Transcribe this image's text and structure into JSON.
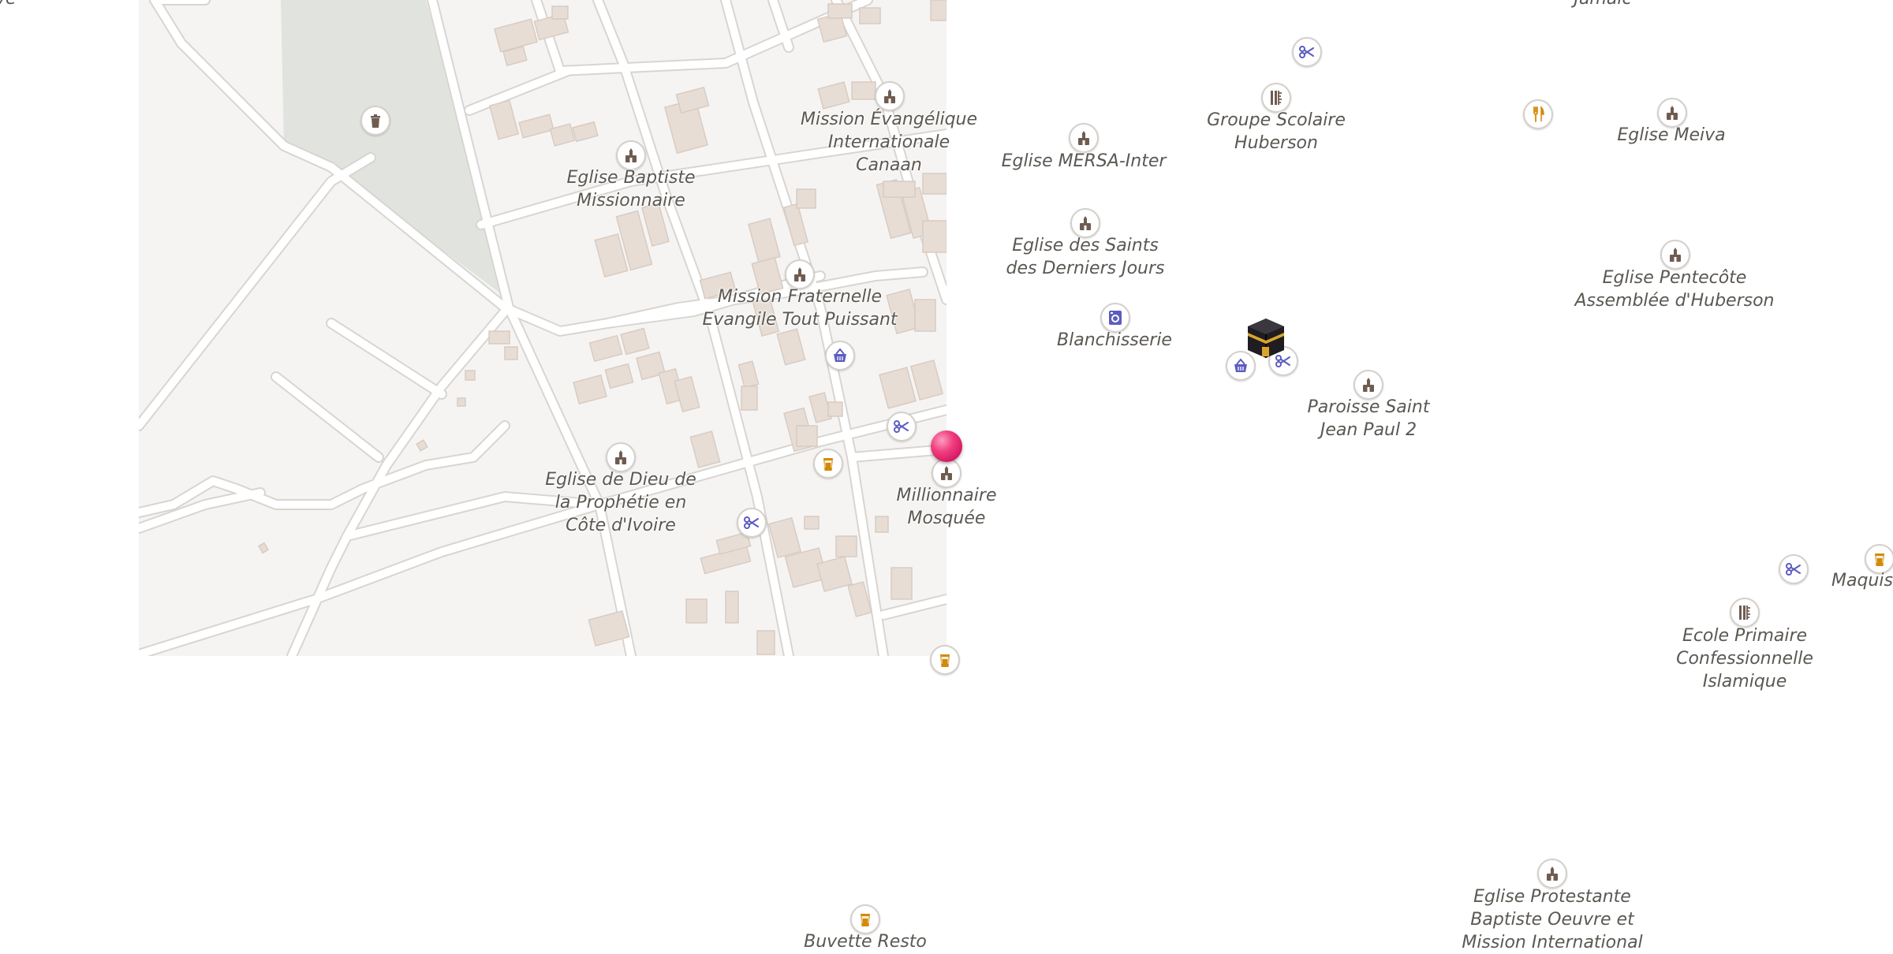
{
  "map": {
    "labels": {
      "top_left_cut": "ve",
      "top_right_cut": "Jamaic",
      "mission_evangelique": "Mission Évangélique\nInternationale\nCanaan",
      "eglise_baptiste": "Eglise Baptiste\nMissionnaire",
      "mission_fraternelle": "Mission Fraternelle\nEvangile Tout Puissant",
      "eglise_mersa": "Eglise MERSA-Inter",
      "groupe_scolaire": "Groupe Scolaire\nHuberson",
      "eglise_meiva": "Eglise Meiva",
      "eglise_saints": "Eglise des Saints\ndes Derniers Jours",
      "blanchisserie": "Blanchisserie",
      "eglise_pentecote": "Eglise Pentecôte\nAssemblée d'Huberson",
      "paroisse": "Paroisse Saint\nJean Paul 2",
      "millionnaire_mosquee": "Millionnaire\nMosquée",
      "eglise_dieu": "Eglise de Dieu de\nla Prophétie en\nCôte d'Ivoire",
      "maquis": "Maquis",
      "ecole_primaire": "Ecole Primaire\nConfessionnelle Islamique",
      "buvette_resto": "Buvette Resto",
      "eglise_protestante": "Eglise Protestante\nBaptiste Oeuvre et\nMission International"
    },
    "colors": {
      "land": "#f6f4f2",
      "building": "#e7ddd5",
      "building_edge": "#d7ccc3",
      "road": "#ffffff",
      "road_casing": "#d8d5d1",
      "park": "#e1e4de",
      "poi_brown": "#6f5c51",
      "poi_blue": "#5c5cc0",
      "poi_orange": "#d28a0b",
      "pin": "#e52b6f"
    }
  }
}
